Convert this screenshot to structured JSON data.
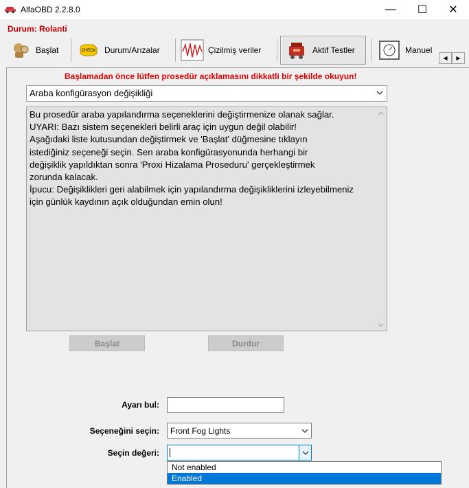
{
  "window": {
    "title": "AlfaOBD 2.2.8.0",
    "minimize_glyph": "—",
    "maximize_glyph": "☐",
    "close_glyph": "✕"
  },
  "status": {
    "text": "Durum: Rolanti",
    "color": "#c00000"
  },
  "toolbar": {
    "tabs": [
      {
        "label": "Başlat",
        "icon": "person-icon"
      },
      {
        "label": "Durum/Arızalar",
        "icon": "check-engine-icon"
      },
      {
        "label": "Çizilmiş veriler",
        "icon": "waveform-icon"
      },
      {
        "label": "Aktif Testler",
        "icon": "engine-icon",
        "active": true
      },
      {
        "label": "Manuel",
        "icon": "gauge-icon"
      }
    ],
    "scroll_left": "◀",
    "scroll_right": "▶"
  },
  "warning": {
    "text": "Başlamadan önce lütfen prosedür açıklamasını dikkatli bir şekilde okuyun!",
    "color": "#e00000"
  },
  "procedure": {
    "selected": "Araba konfigürasyon değişikliği"
  },
  "description": {
    "text": "Bu prosedür araba yapılandırma seçeneklerini değiştirmenize olanak sağlar.\nUYARI: Bazı sistem seçenekleri belirli araç için uygun değil olabilir!\nAşağıdaki liste kutusundan değiştirmek ve 'Başlat' düğmesine tıklayın\nistediğiniz seçeneği seçin. Sen araba konfigürasyonunda herhangi bir\ndeğişiklik yapıldıktan sonra 'Proxi Hizalama Proseduru' gerçekleştirmek\nzorunda kalacak.\nİpucu: Değişiklikleri geri alabilmek için yapılandırma değişikliklerini izleyebilmeniz\niçin günlük kaydının açık olduğundan emin olun!"
  },
  "buttons": {
    "start": "Başlat",
    "stop": "Durdur"
  },
  "form": {
    "find_label": "Ayarı bul:",
    "find_value": "",
    "option_label": "Seçeneğini seçin:",
    "option_value": "Front Fog Lights",
    "value_label": "Seçin değeri:",
    "value_value": ""
  },
  "dropdown": {
    "options": [
      "Not enabled",
      "Enabled"
    ],
    "selected_index": 1
  },
  "colors": {
    "accent": "#0078d7",
    "panel_bg": "#f0f0f0",
    "desc_bg": "#e3e3e3"
  }
}
